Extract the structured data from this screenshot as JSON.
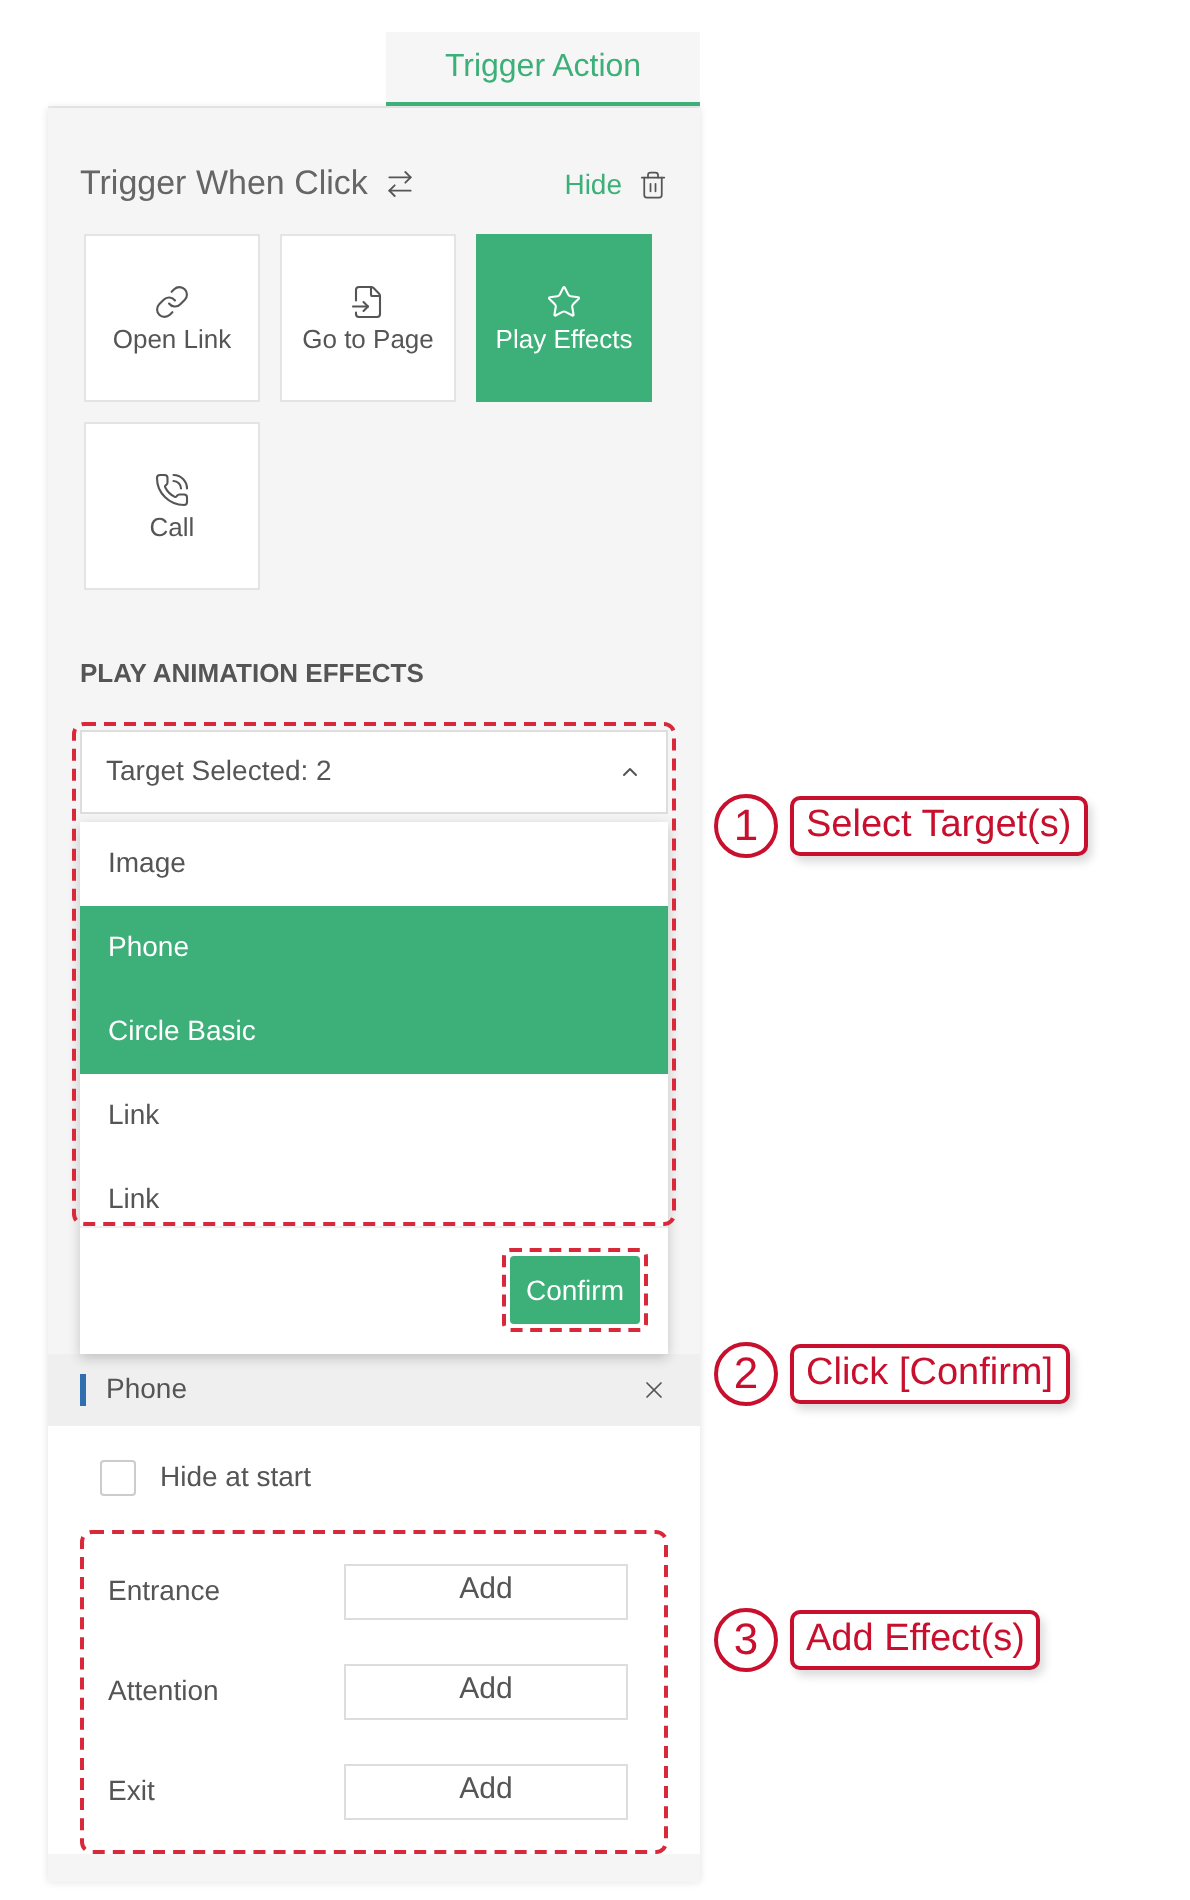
{
  "tabs": [
    {
      "label": "Trigger Action",
      "selected": true
    }
  ],
  "trigger": {
    "title": "Trigger When Click",
    "hide": "Hide"
  },
  "actions": [
    {
      "kind": "link",
      "label": "Open Link",
      "selected": false
    },
    {
      "kind": "page",
      "label": "Go to Page",
      "selected": false
    },
    {
      "kind": "effects",
      "label": "Play Effects",
      "selected": true
    },
    {
      "kind": "call",
      "label": "Call",
      "selected": false
    }
  ],
  "section_title": "PLAY ANIMATION EFFECTS",
  "target_select": {
    "summary": "Target Selected: 2",
    "expanded": true,
    "confirm": "Confirm",
    "options": [
      {
        "label": "Image",
        "selected": false
      },
      {
        "label": "Phone",
        "selected": true
      },
      {
        "label": "Circle Basic",
        "selected": true
      },
      {
        "label": "Link",
        "selected": false
      },
      {
        "label": "Link",
        "selected": false
      }
    ]
  },
  "target_item": {
    "name": "Phone"
  },
  "hide_at_start": {
    "label": "Hide at start",
    "checked": false
  },
  "effects": [
    {
      "label": "Entrance",
      "button": "Add"
    },
    {
      "label": "Attention",
      "button": "Add"
    },
    {
      "label": "Exit",
      "button": "Add"
    }
  ],
  "annotations": [
    {
      "number": "1",
      "text": "Select Target(s)"
    },
    {
      "number": "2",
      "text": "Click [Confirm]"
    },
    {
      "number": "3",
      "text": "Add Effect(s)"
    }
  ]
}
